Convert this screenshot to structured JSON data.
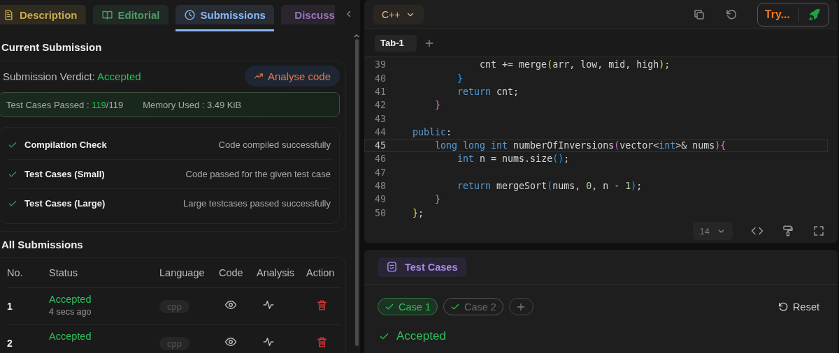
{
  "left_panel": {
    "tabs": [
      {
        "label": "Description",
        "color": "#c9a94c",
        "selected": false
      },
      {
        "label": "Editorial",
        "color": "#4f9a66",
        "selected": false
      },
      {
        "label": "Submissions",
        "color": "#8ab8f5",
        "selected": true
      },
      {
        "label": "Discuss",
        "color": "#9b72b8",
        "selected": false
      }
    ],
    "current_submission": {
      "title": "Current Submission",
      "verdict_label": "Submission Verdict:",
      "verdict": "Accepted",
      "analyse_button": "Analyse code",
      "stats": {
        "passed_label": "Test Cases Passed :",
        "passed": "119",
        "total": "/119",
        "memory": "Memory Used : 3.49 KiB"
      },
      "checks": [
        {
          "name": "Compilation Check",
          "detail": "Code compiled successfully"
        },
        {
          "name": "Test Cases (Small)",
          "detail": "Code passed for the given test case"
        },
        {
          "name": "Test Cases (Large)",
          "detail": "Large testcases passed successfully"
        }
      ]
    },
    "all_submissions": {
      "title": "All Submissions",
      "columns": [
        "No.",
        "Status",
        "Language",
        "Code",
        "Analysis",
        "Action"
      ],
      "rows": [
        {
          "no": "1",
          "status": "Accepted",
          "time": "4 secs ago",
          "language": "cpp"
        },
        {
          "no": "2",
          "status": "Accepted",
          "language": "cpp"
        }
      ]
    }
  },
  "editor": {
    "language": "C++",
    "run_button": "Try...",
    "tabs": [
      {
        "label": "Tab-1",
        "selected": true
      }
    ],
    "lines": [
      {
        "number": "39",
        "active": false,
        "tokens": [
          {
            "kind": "plain",
            "text": "            cnt += merge"
          },
          {
            "kind": "b1",
            "text": "("
          },
          {
            "kind": "plain",
            "text": "arr, low, mid, high"
          },
          {
            "kind": "b1",
            "text": ")"
          },
          {
            "kind": "plain",
            "text": ";"
          }
        ]
      },
      {
        "number": "40",
        "active": false,
        "tokens": [
          {
            "kind": "b3",
            "text": "        }"
          }
        ]
      },
      {
        "number": "41",
        "active": false,
        "tokens": [
          {
            "kind": "keyword",
            "text": "        return"
          },
          {
            "kind": "plain",
            "text": " cnt;"
          }
        ]
      },
      {
        "number": "42",
        "active": false,
        "tokens": [
          {
            "kind": "b2",
            "text": "    }"
          }
        ]
      },
      {
        "number": "43",
        "active": false
      },
      {
        "number": "44",
        "active": false,
        "tokens": [
          {
            "kind": "keyword",
            "text": "public"
          },
          {
            "kind": "plain",
            "text": ":"
          }
        ]
      },
      {
        "number": "45",
        "active": true,
        "tokens": [
          {
            "kind": "keyword",
            "text": "    long long int"
          },
          {
            "kind": "plain",
            "text": " numberOfInversions"
          },
          {
            "kind": "b2",
            "text": "("
          },
          {
            "kind": "plain",
            "text": "vector<"
          },
          {
            "kind": "keyword",
            "text": "int"
          },
          {
            "kind": "plain",
            "text": ">& nums"
          },
          {
            "kind": "b2",
            "text": "){"
          }
        ]
      },
      {
        "number": "46",
        "active": false,
        "tokens": [
          {
            "kind": "keyword",
            "text": "        int"
          },
          {
            "kind": "plain",
            "text": " n = nums.size"
          },
          {
            "kind": "b3",
            "text": "()"
          },
          {
            "kind": "plain",
            "text": ";"
          }
        ]
      },
      {
        "number": "47",
        "active": false
      },
      {
        "number": "48",
        "active": false,
        "tokens": [
          {
            "kind": "keyword",
            "text": "        return"
          },
          {
            "kind": "plain",
            "text": " mergeSort"
          },
          {
            "kind": "b3",
            "text": "("
          },
          {
            "kind": "plain",
            "text": "nums, "
          },
          {
            "kind": "num",
            "text": "0"
          },
          {
            "kind": "plain",
            "text": ", n - "
          },
          {
            "kind": "num",
            "text": "1"
          },
          {
            "kind": "b3",
            "text": ")"
          },
          {
            "kind": "plain",
            "text": ";"
          }
        ]
      },
      {
        "number": "49",
        "active": false,
        "tokens": [
          {
            "kind": "b2",
            "text": "    }"
          }
        ]
      },
      {
        "number": "50",
        "active": false,
        "tokens": [
          {
            "kind": "b1",
            "text": "}"
          },
          {
            "kind": "plain",
            "text": ";"
          }
        ]
      }
    ],
    "font_size": "14"
  },
  "test_panel": {
    "tab": "Test Cases",
    "cases": [
      {
        "label": "Case 1",
        "selected": true
      },
      {
        "label": "Case 2",
        "selected": false
      }
    ],
    "reset_button": "Reset",
    "result": "Accepted"
  }
}
